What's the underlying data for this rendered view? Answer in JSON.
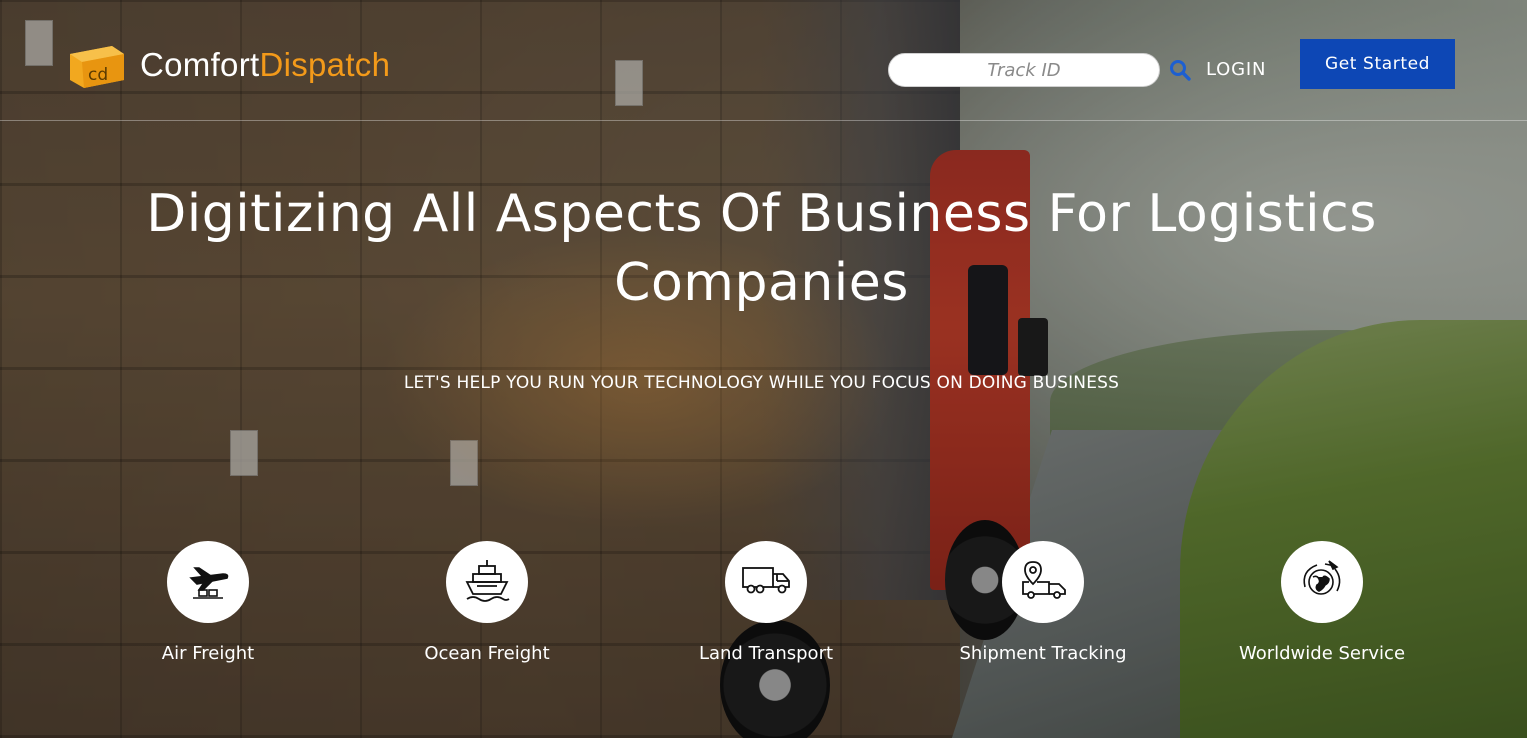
{
  "brand": {
    "name_part1": "Comfort",
    "name_part2": "Dispatch",
    "logo_text": "cd",
    "accent_color": "#f39a1a"
  },
  "header": {
    "track_placeholder": "Track ID",
    "search_icon": "search-icon",
    "login_label": "LOGIN",
    "cta_label": "Get Started",
    "cta_color": "#0d47b5"
  },
  "hero": {
    "headline": "Digitizing All Aspects Of Business For Logistics Companies",
    "subheadline": "LET'S HELP YOU RUN YOUR TECHNOLOGY WHILE YOU FOCUS ON DOING BUSINESS"
  },
  "services": [
    {
      "label": "Air Freight",
      "icon": "airplane-icon"
    },
    {
      "label": "Ocean Freight",
      "icon": "ship-icon"
    },
    {
      "label": "Land Transport",
      "icon": "truck-icon"
    },
    {
      "label": "Shipment Tracking",
      "icon": "tracking-truck-icon"
    },
    {
      "label": "Worldwide Service",
      "icon": "globe-icon"
    }
  ]
}
